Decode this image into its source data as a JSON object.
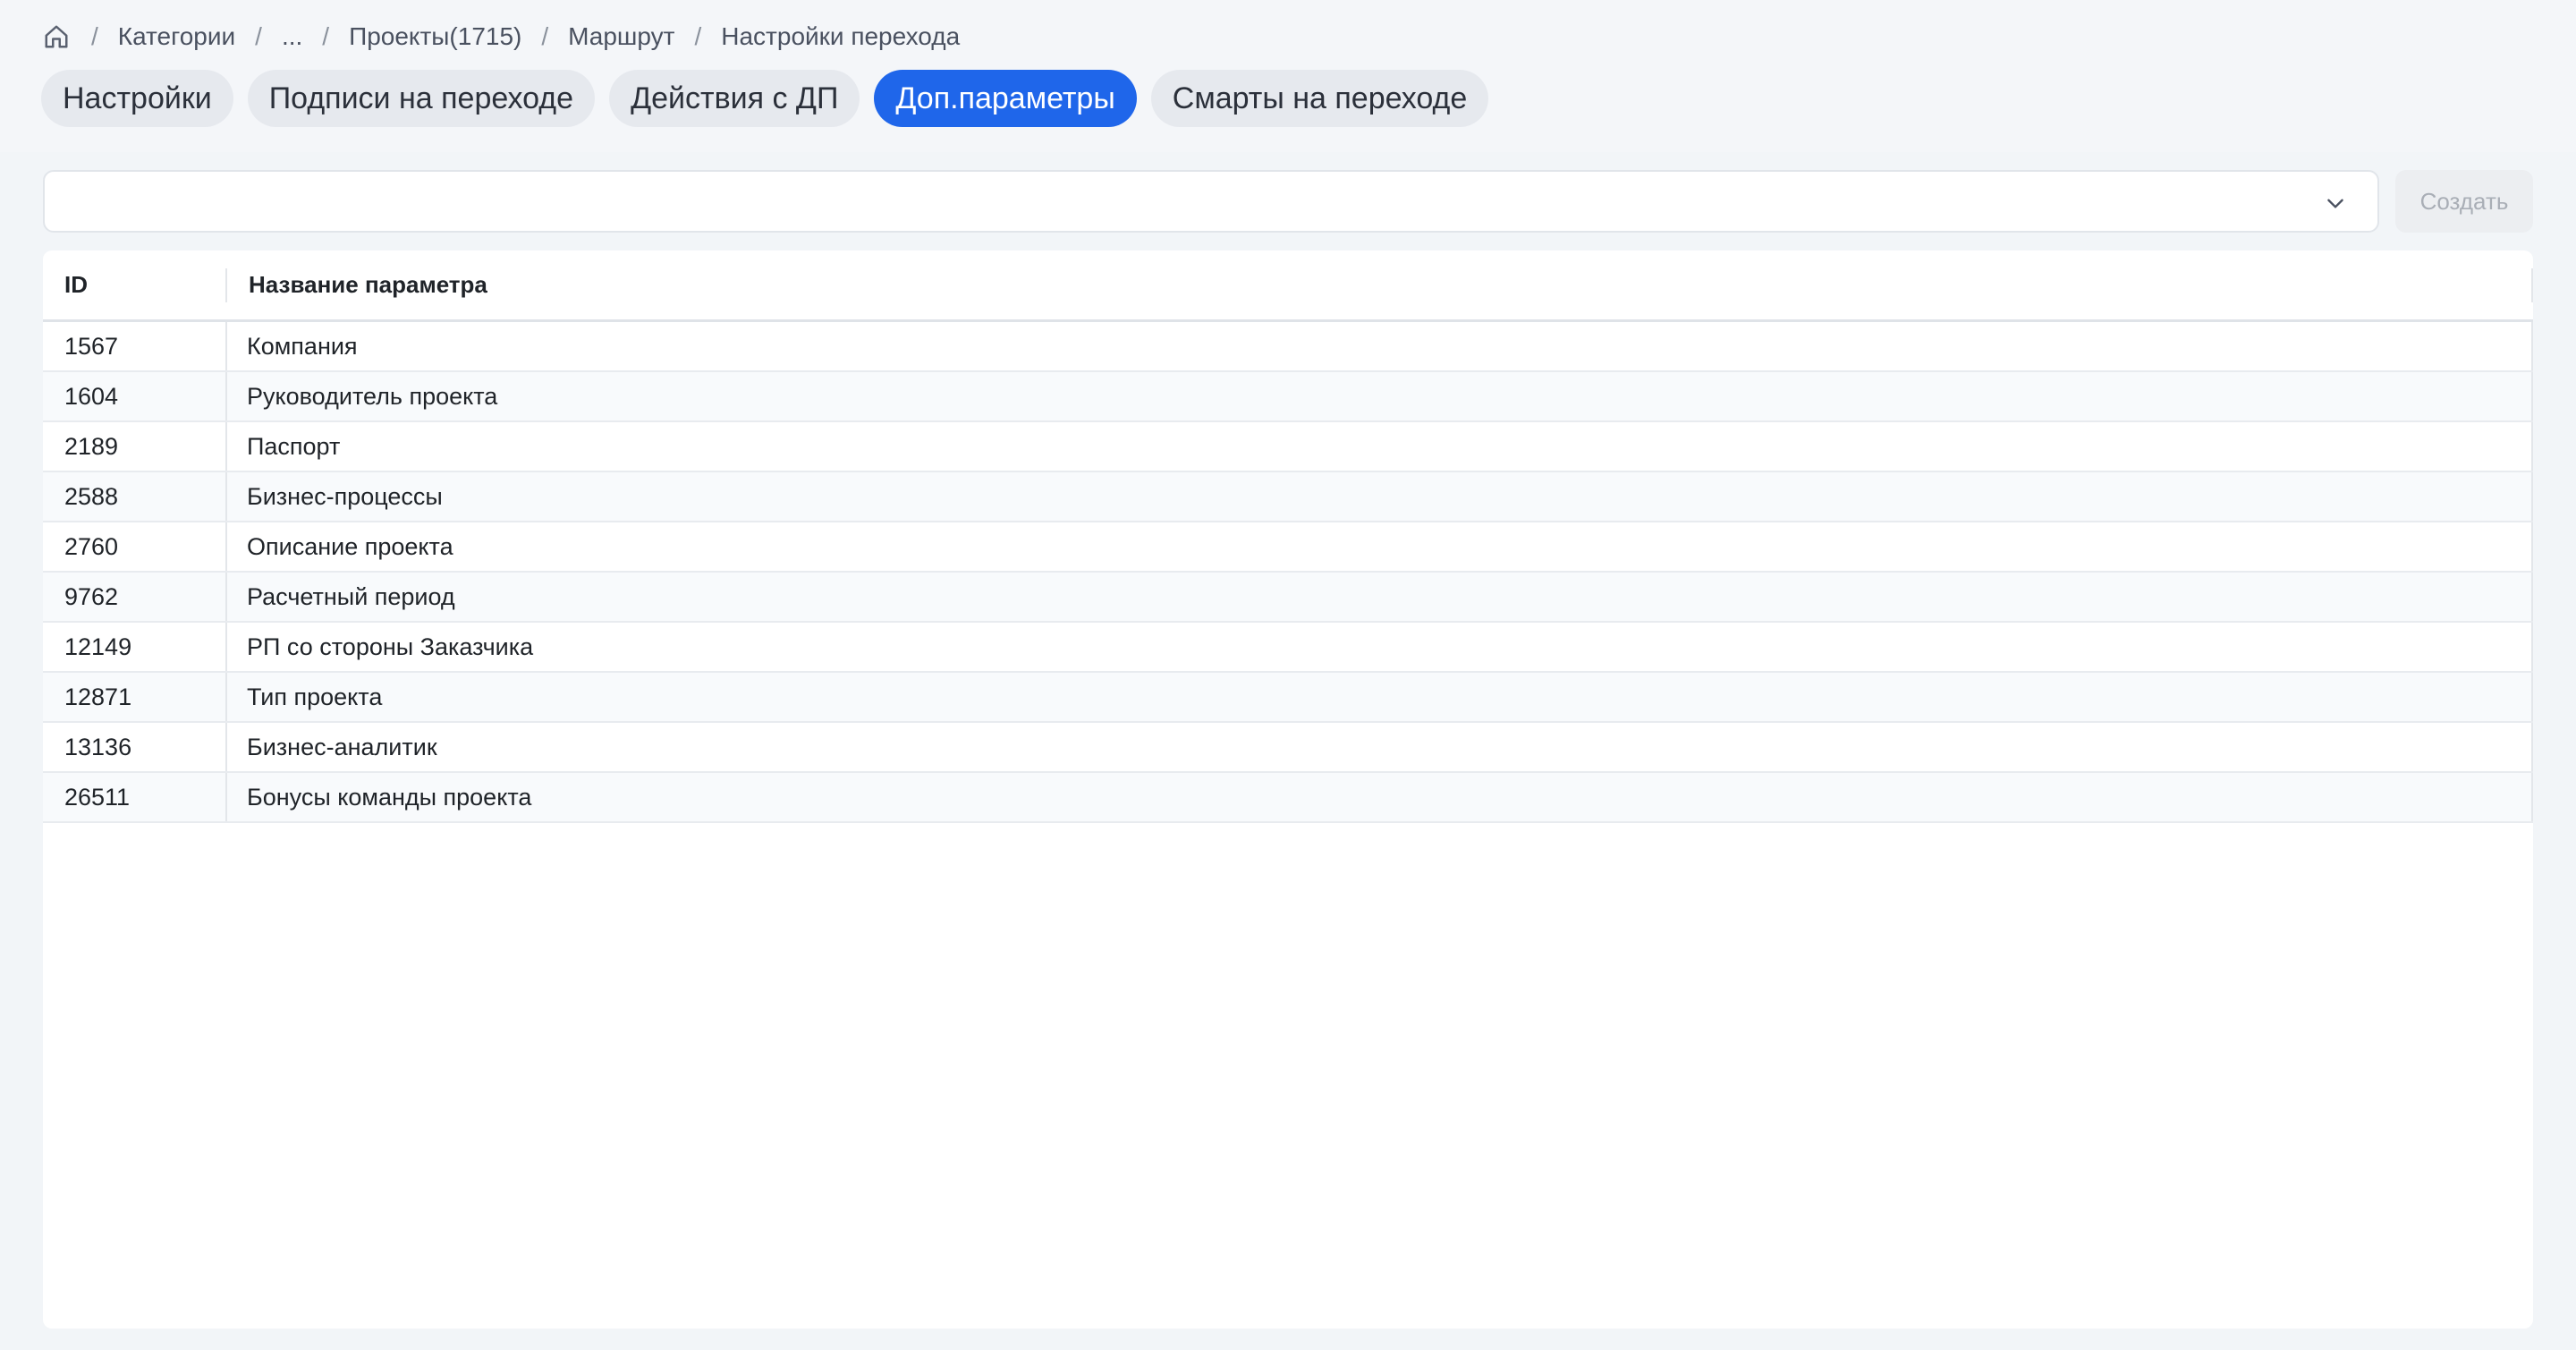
{
  "breadcrumb": {
    "items": [
      "Категории",
      "...",
      "Проекты(1715)",
      "Маршрут",
      "Настройки перехода"
    ],
    "separator": "/"
  },
  "tabs": [
    {
      "label": "Настройки",
      "active": false
    },
    {
      "label": "Подписи на переходе",
      "active": false
    },
    {
      "label": "Действия с ДП",
      "active": false
    },
    {
      "label": "Доп.параметры",
      "active": true
    },
    {
      "label": "Смарты на переходе",
      "active": false
    }
  ],
  "selector": {
    "value": "",
    "icon": "chevron-down-icon"
  },
  "create_button": {
    "label": "Создать",
    "disabled": true
  },
  "table": {
    "columns": [
      "ID",
      "Название параметра"
    ],
    "rows": [
      [
        "1567",
        "Компания"
      ],
      [
        "1604",
        "Руководитель проекта"
      ],
      [
        "2189",
        "Паспорт"
      ],
      [
        "2588",
        "Бизнес-процессы"
      ],
      [
        "2760",
        "Описание проекта"
      ],
      [
        "9762",
        "Расчетный период"
      ],
      [
        "12149",
        "РП со стороны Заказчика"
      ],
      [
        "12871",
        "Тип проекта"
      ],
      [
        "13136",
        "Бизнес-аналитик"
      ],
      [
        "26511",
        "Бонусы команды проекта"
      ]
    ]
  },
  "colors": {
    "accent": "#1f66ea",
    "background": "#f2f5f8"
  }
}
